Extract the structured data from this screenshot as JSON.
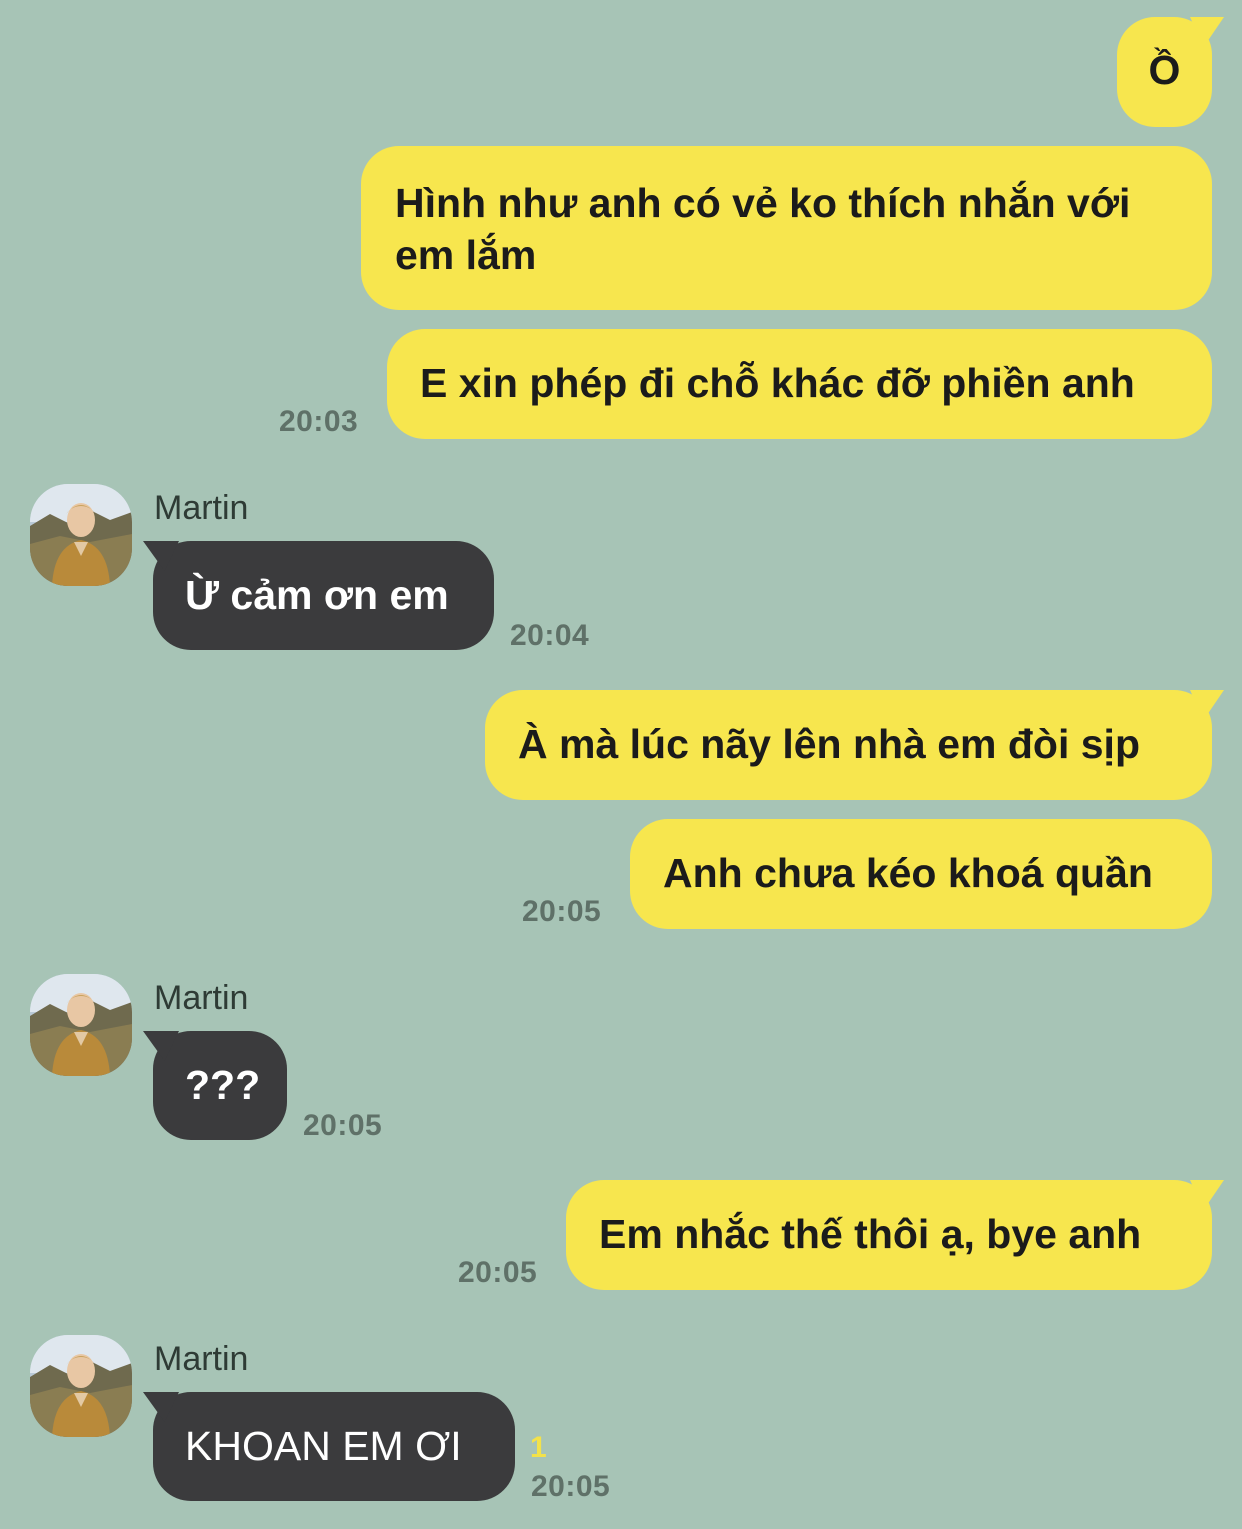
{
  "conversation": {
    "contact_name": "Martin",
    "messages": [
      {
        "from": "me",
        "text": "Ồ"
      },
      {
        "from": "me",
        "line1": "Hình như anh có vẻ ko thích nhắn với",
        "line2": "em lắm"
      },
      {
        "from": "me",
        "text": "E xin phép đi chỗ khác đỡ phiền anh",
        "time": "20:03"
      },
      {
        "from": "Martin",
        "text": "Ừ cảm ơn em",
        "time": "20:04"
      },
      {
        "from": "me",
        "text": "À mà lúc nãy lên nhà em đòi sịp"
      },
      {
        "from": "me",
        "text": "Anh chưa kéo khoá quần",
        "time": "20:05"
      },
      {
        "from": "Martin",
        "text": "???",
        "time": "20:05"
      },
      {
        "from": "me",
        "text": "Em nhắc thế thôi ạ, bye anh",
        "time": "20:05"
      },
      {
        "from": "Martin",
        "text": "KHOAN EM ƠI",
        "time": "20:05",
        "unread": "1"
      }
    ]
  },
  "colors": {
    "background": "#a7c4b6",
    "outgoing_bubble": "#f7e64e",
    "incoming_bubble": "#3b3b3d",
    "timestamp": "#5f7168",
    "unread_count": "#f3e24a"
  },
  "icons": {
    "avatar": "avatar-photo"
  }
}
